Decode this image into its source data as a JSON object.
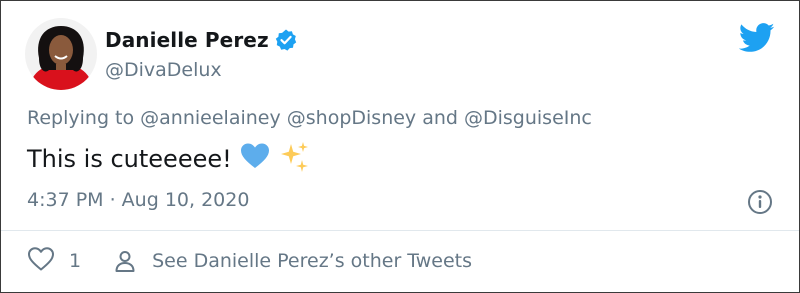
{
  "author": {
    "display_name": "Danielle Perez",
    "handle": "@DivaDelux",
    "verified": true
  },
  "reply": {
    "text": "Replying to @annieelainey @shopDisney and @DisguiseInc"
  },
  "tweet": {
    "text": "This is cuteeeee!",
    "emojis": [
      "blue-heart",
      "sparkles"
    ]
  },
  "meta": {
    "timestamp": "4:37 PM · Aug 10, 2020"
  },
  "actions": {
    "like_count": "1",
    "other_tweets_label": "See Danielle Perez’s other Tweets"
  },
  "colors": {
    "twitter_blue": "#1da1f2",
    "text_primary": "#14171a",
    "text_secondary": "#657786",
    "divider": "#e1e8ed"
  }
}
